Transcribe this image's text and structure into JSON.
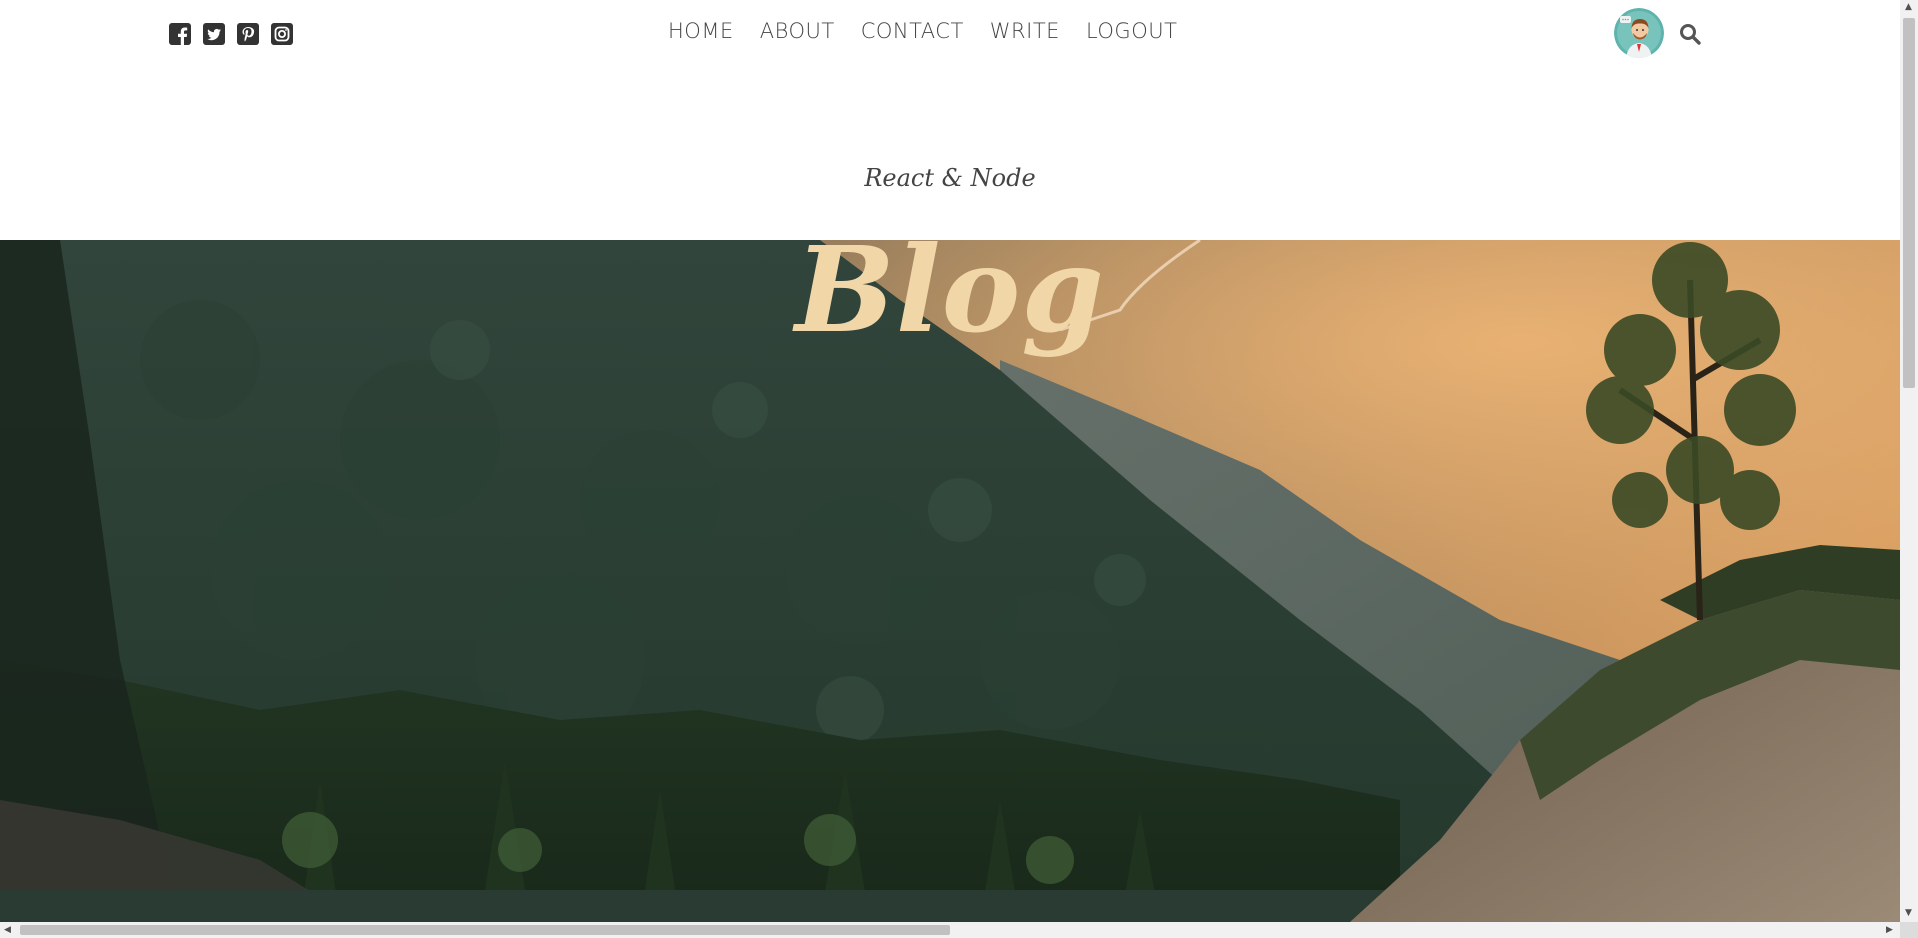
{
  "topbar": {
    "social": [
      {
        "name": "facebook-icon"
      },
      {
        "name": "twitter-icon"
      },
      {
        "name": "pinterest-icon"
      },
      {
        "name": "instagram-icon"
      }
    ],
    "nav": [
      "HOME",
      "ABOUT",
      "CONTACT",
      "WRITE",
      "LOGOUT"
    ],
    "avatar_icon": "profile-avatar",
    "search_icon": "search-icon"
  },
  "header": {
    "subtitle": "React & Node",
    "title": "Blog"
  },
  "colors": {
    "title": "#f1d6a8",
    "nav_text": "#444444",
    "icon": "#333333"
  }
}
